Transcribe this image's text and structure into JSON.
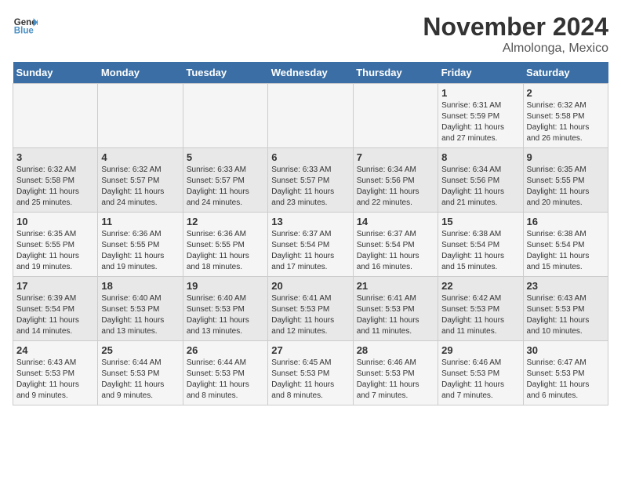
{
  "header": {
    "logo_line1": "General",
    "logo_line2": "Blue",
    "title": "November 2024",
    "subtitle": "Almolonga, Mexico"
  },
  "weekdays": [
    "Sunday",
    "Monday",
    "Tuesday",
    "Wednesday",
    "Thursday",
    "Friday",
    "Saturday"
  ],
  "weeks": [
    [
      {
        "day": "",
        "info": ""
      },
      {
        "day": "",
        "info": ""
      },
      {
        "day": "",
        "info": ""
      },
      {
        "day": "",
        "info": ""
      },
      {
        "day": "",
        "info": ""
      },
      {
        "day": "1",
        "info": "Sunrise: 6:31 AM\nSunset: 5:59 PM\nDaylight: 11 hours\nand 27 minutes."
      },
      {
        "day": "2",
        "info": "Sunrise: 6:32 AM\nSunset: 5:58 PM\nDaylight: 11 hours\nand 26 minutes."
      }
    ],
    [
      {
        "day": "3",
        "info": "Sunrise: 6:32 AM\nSunset: 5:58 PM\nDaylight: 11 hours\nand 25 minutes."
      },
      {
        "day": "4",
        "info": "Sunrise: 6:32 AM\nSunset: 5:57 PM\nDaylight: 11 hours\nand 24 minutes."
      },
      {
        "day": "5",
        "info": "Sunrise: 6:33 AM\nSunset: 5:57 PM\nDaylight: 11 hours\nand 24 minutes."
      },
      {
        "day": "6",
        "info": "Sunrise: 6:33 AM\nSunset: 5:57 PM\nDaylight: 11 hours\nand 23 minutes."
      },
      {
        "day": "7",
        "info": "Sunrise: 6:34 AM\nSunset: 5:56 PM\nDaylight: 11 hours\nand 22 minutes."
      },
      {
        "day": "8",
        "info": "Sunrise: 6:34 AM\nSunset: 5:56 PM\nDaylight: 11 hours\nand 21 minutes."
      },
      {
        "day": "9",
        "info": "Sunrise: 6:35 AM\nSunset: 5:55 PM\nDaylight: 11 hours\nand 20 minutes."
      }
    ],
    [
      {
        "day": "10",
        "info": "Sunrise: 6:35 AM\nSunset: 5:55 PM\nDaylight: 11 hours\nand 19 minutes."
      },
      {
        "day": "11",
        "info": "Sunrise: 6:36 AM\nSunset: 5:55 PM\nDaylight: 11 hours\nand 19 minutes."
      },
      {
        "day": "12",
        "info": "Sunrise: 6:36 AM\nSunset: 5:55 PM\nDaylight: 11 hours\nand 18 minutes."
      },
      {
        "day": "13",
        "info": "Sunrise: 6:37 AM\nSunset: 5:54 PM\nDaylight: 11 hours\nand 17 minutes."
      },
      {
        "day": "14",
        "info": "Sunrise: 6:37 AM\nSunset: 5:54 PM\nDaylight: 11 hours\nand 16 minutes."
      },
      {
        "day": "15",
        "info": "Sunrise: 6:38 AM\nSunset: 5:54 PM\nDaylight: 11 hours\nand 15 minutes."
      },
      {
        "day": "16",
        "info": "Sunrise: 6:38 AM\nSunset: 5:54 PM\nDaylight: 11 hours\nand 15 minutes."
      }
    ],
    [
      {
        "day": "17",
        "info": "Sunrise: 6:39 AM\nSunset: 5:54 PM\nDaylight: 11 hours\nand 14 minutes."
      },
      {
        "day": "18",
        "info": "Sunrise: 6:40 AM\nSunset: 5:53 PM\nDaylight: 11 hours\nand 13 minutes."
      },
      {
        "day": "19",
        "info": "Sunrise: 6:40 AM\nSunset: 5:53 PM\nDaylight: 11 hours\nand 13 minutes."
      },
      {
        "day": "20",
        "info": "Sunrise: 6:41 AM\nSunset: 5:53 PM\nDaylight: 11 hours\nand 12 minutes."
      },
      {
        "day": "21",
        "info": "Sunrise: 6:41 AM\nSunset: 5:53 PM\nDaylight: 11 hours\nand 11 minutes."
      },
      {
        "day": "22",
        "info": "Sunrise: 6:42 AM\nSunset: 5:53 PM\nDaylight: 11 hours\nand 11 minutes."
      },
      {
        "day": "23",
        "info": "Sunrise: 6:43 AM\nSunset: 5:53 PM\nDaylight: 11 hours\nand 10 minutes."
      }
    ],
    [
      {
        "day": "24",
        "info": "Sunrise: 6:43 AM\nSunset: 5:53 PM\nDaylight: 11 hours\nand 9 minutes."
      },
      {
        "day": "25",
        "info": "Sunrise: 6:44 AM\nSunset: 5:53 PM\nDaylight: 11 hours\nand 9 minutes."
      },
      {
        "day": "26",
        "info": "Sunrise: 6:44 AM\nSunset: 5:53 PM\nDaylight: 11 hours\nand 8 minutes."
      },
      {
        "day": "27",
        "info": "Sunrise: 6:45 AM\nSunset: 5:53 PM\nDaylight: 11 hours\nand 8 minutes."
      },
      {
        "day": "28",
        "info": "Sunrise: 6:46 AM\nSunset: 5:53 PM\nDaylight: 11 hours\nand 7 minutes."
      },
      {
        "day": "29",
        "info": "Sunrise: 6:46 AM\nSunset: 5:53 PM\nDaylight: 11 hours\nand 7 minutes."
      },
      {
        "day": "30",
        "info": "Sunrise: 6:47 AM\nSunset: 5:53 PM\nDaylight: 11 hours\nand 6 minutes."
      }
    ]
  ]
}
